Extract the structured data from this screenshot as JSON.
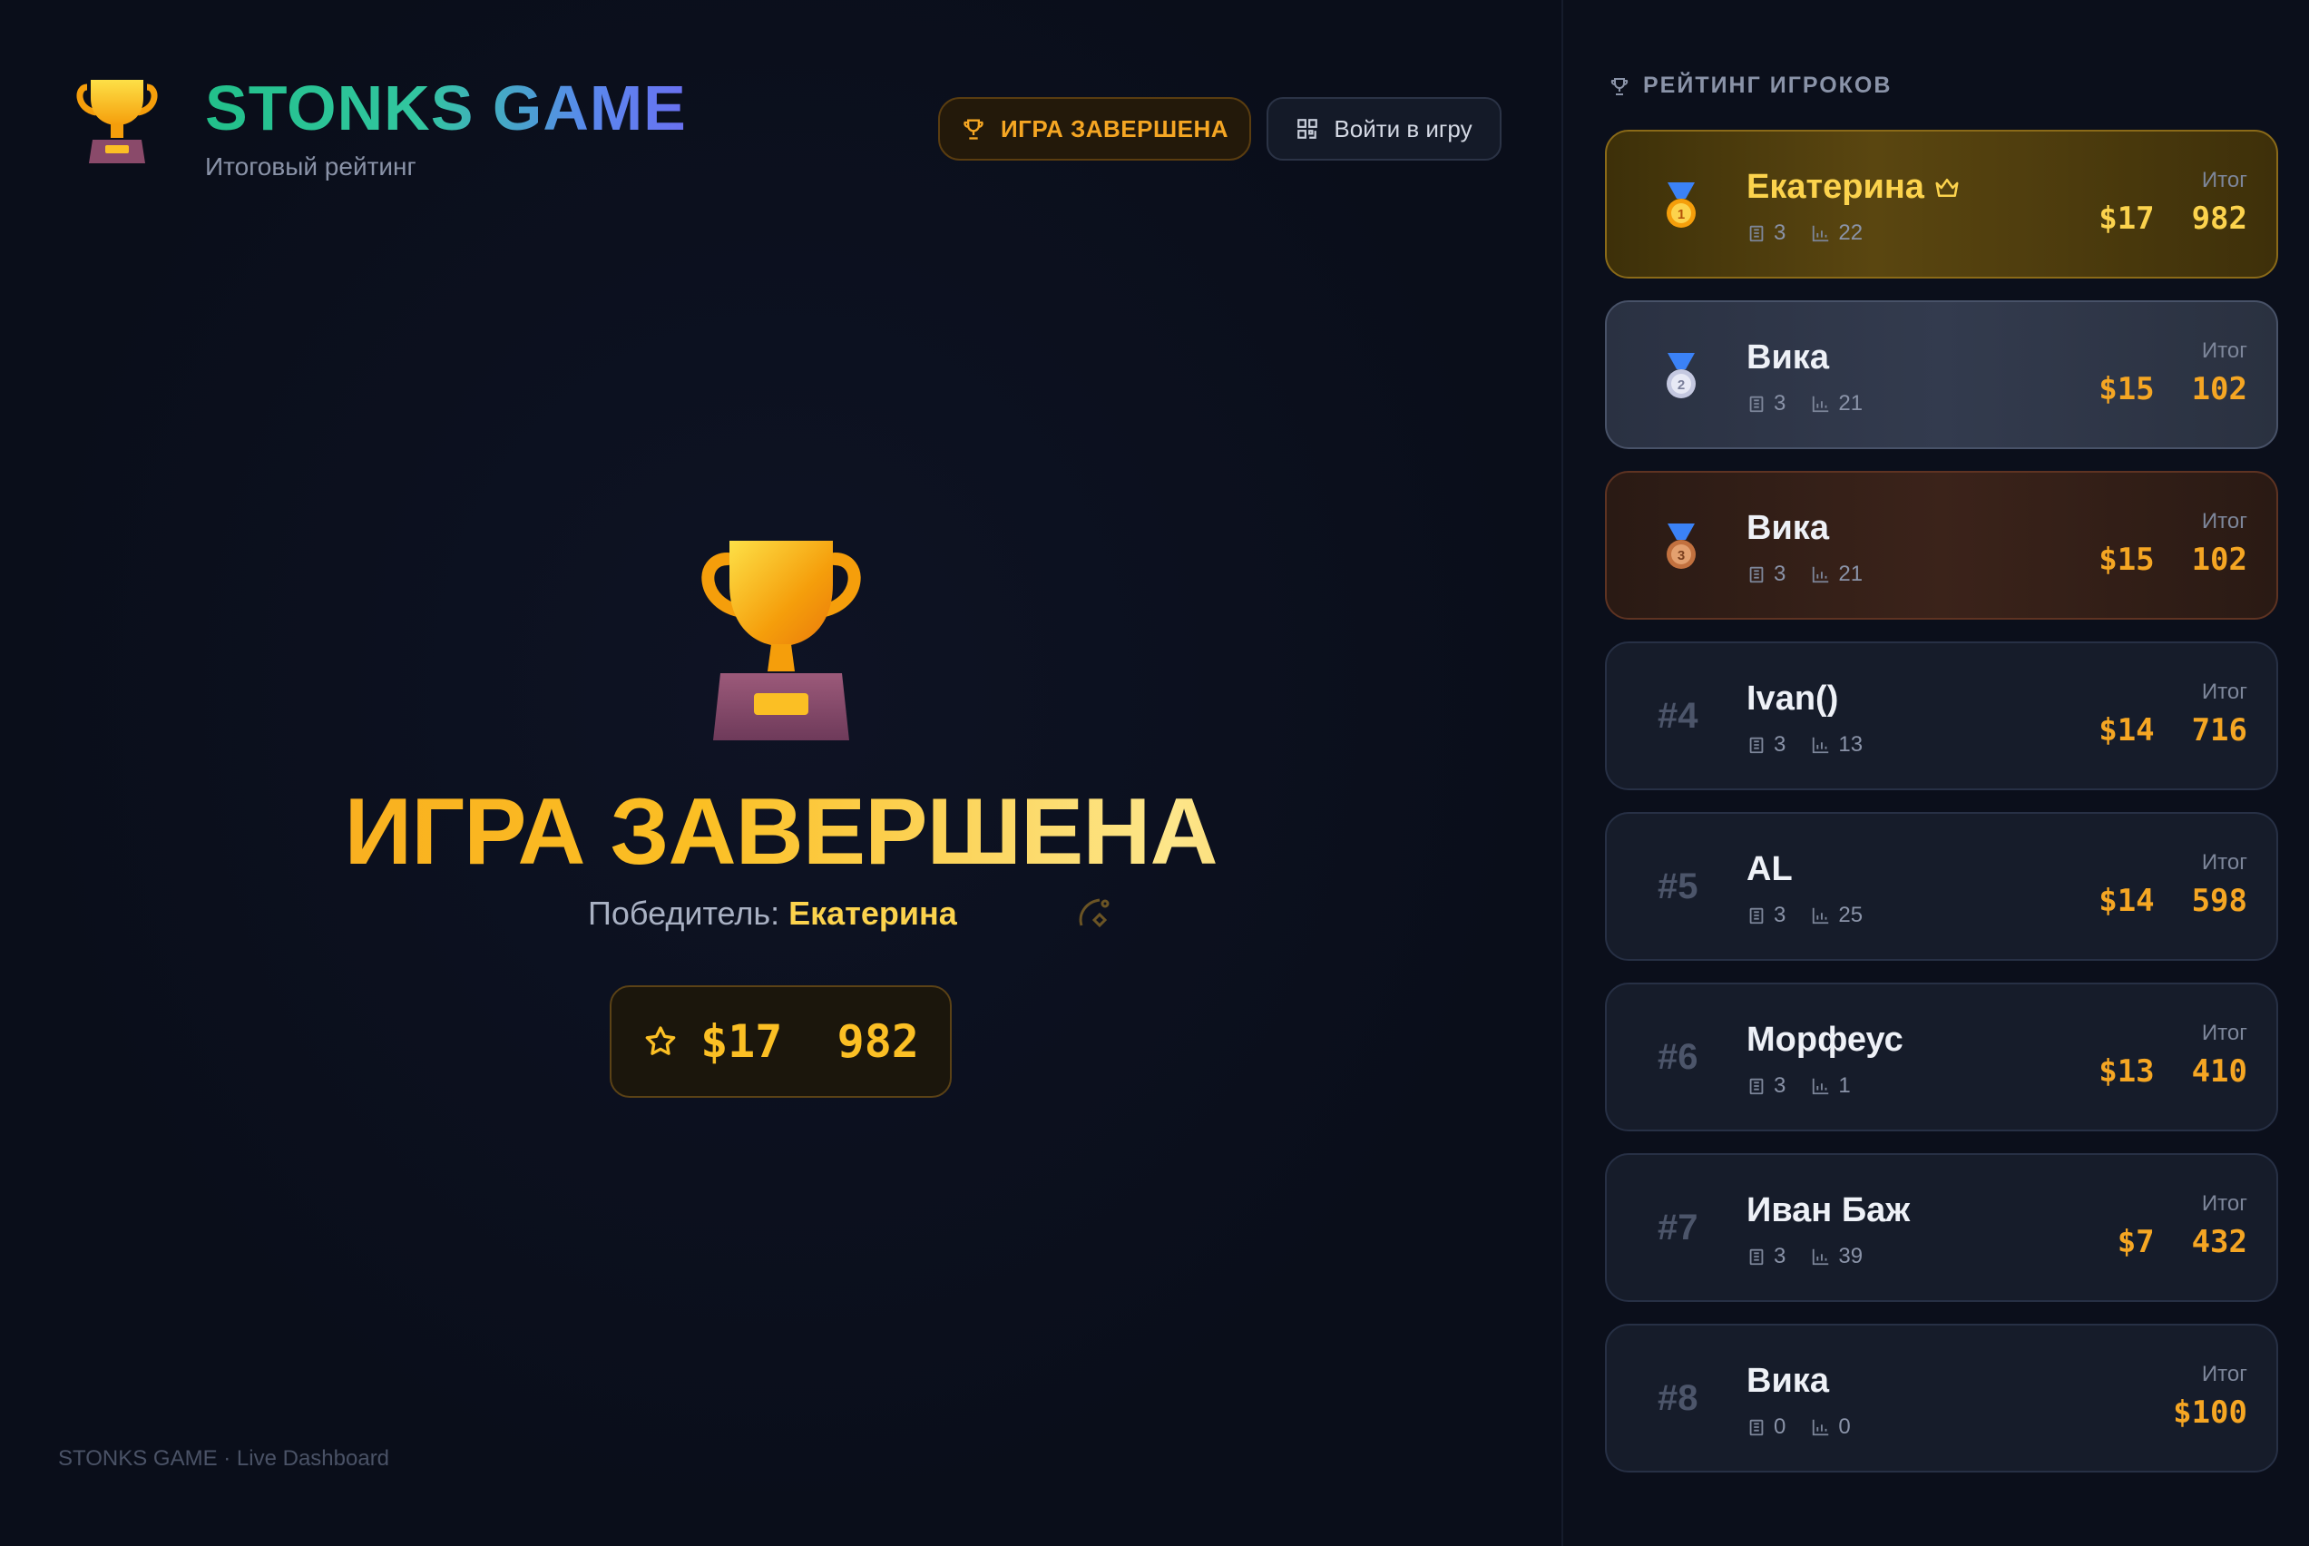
{
  "header": {
    "title": "STONKS GAME",
    "subtitle": "Итоговый рейтинг",
    "status_button": "ИГРА ЗАВЕРШЕНА",
    "join_button": "Войти в игру"
  },
  "main": {
    "headline": "ИГРА ЗАВЕРШЕНА",
    "winner_label": "Победитель:",
    "winner_name": "Екатерина",
    "winner_score": "$17  982"
  },
  "footer": {
    "text": "STONKS GAME · Live Dashboard"
  },
  "sidebar": {
    "title": "РЕЙТИНГ ИГРОКОВ",
    "total_label": "Итог",
    "players": [
      {
        "rank": "1",
        "medal": "gold-medal-icon",
        "name": "Екатерина",
        "crown": true,
        "stat_a": "3",
        "stat_b": "22",
        "total": "$17  982"
      },
      {
        "rank": "2",
        "medal": "silver-medal-icon",
        "name": "Вика",
        "stat_a": "3",
        "stat_b": "21",
        "total": "$15  102"
      },
      {
        "rank": "3",
        "medal": "bronze-medal-icon",
        "name": "Вика",
        "stat_a": "3",
        "stat_b": "21",
        "total": "$15  102"
      },
      {
        "rank": "#4",
        "name": "Ivan()",
        "stat_a": "3",
        "stat_b": "13",
        "total": "$14  716"
      },
      {
        "rank": "#5",
        "name": "AL",
        "stat_a": "3",
        "stat_b": "25",
        "total": "$14  598"
      },
      {
        "rank": "#6",
        "name": "Морфеус",
        "stat_a": "3",
        "stat_b": "1",
        "total": "$13  410"
      },
      {
        "rank": "#7",
        "name": "Иван Баж",
        "stat_a": "3",
        "stat_b": "39",
        "total": "$7  432"
      },
      {
        "rank": "#8",
        "name": "Вика",
        "stat_a": "0",
        "stat_b": "0",
        "total": "$100"
      }
    ]
  },
  "colors": {
    "accent_gold": "#fbbf24",
    "accent_orange": "#f5a623",
    "brand_green": "#22c08a",
    "brand_blue": "#6a70f0",
    "background": "#0a0e1a"
  }
}
